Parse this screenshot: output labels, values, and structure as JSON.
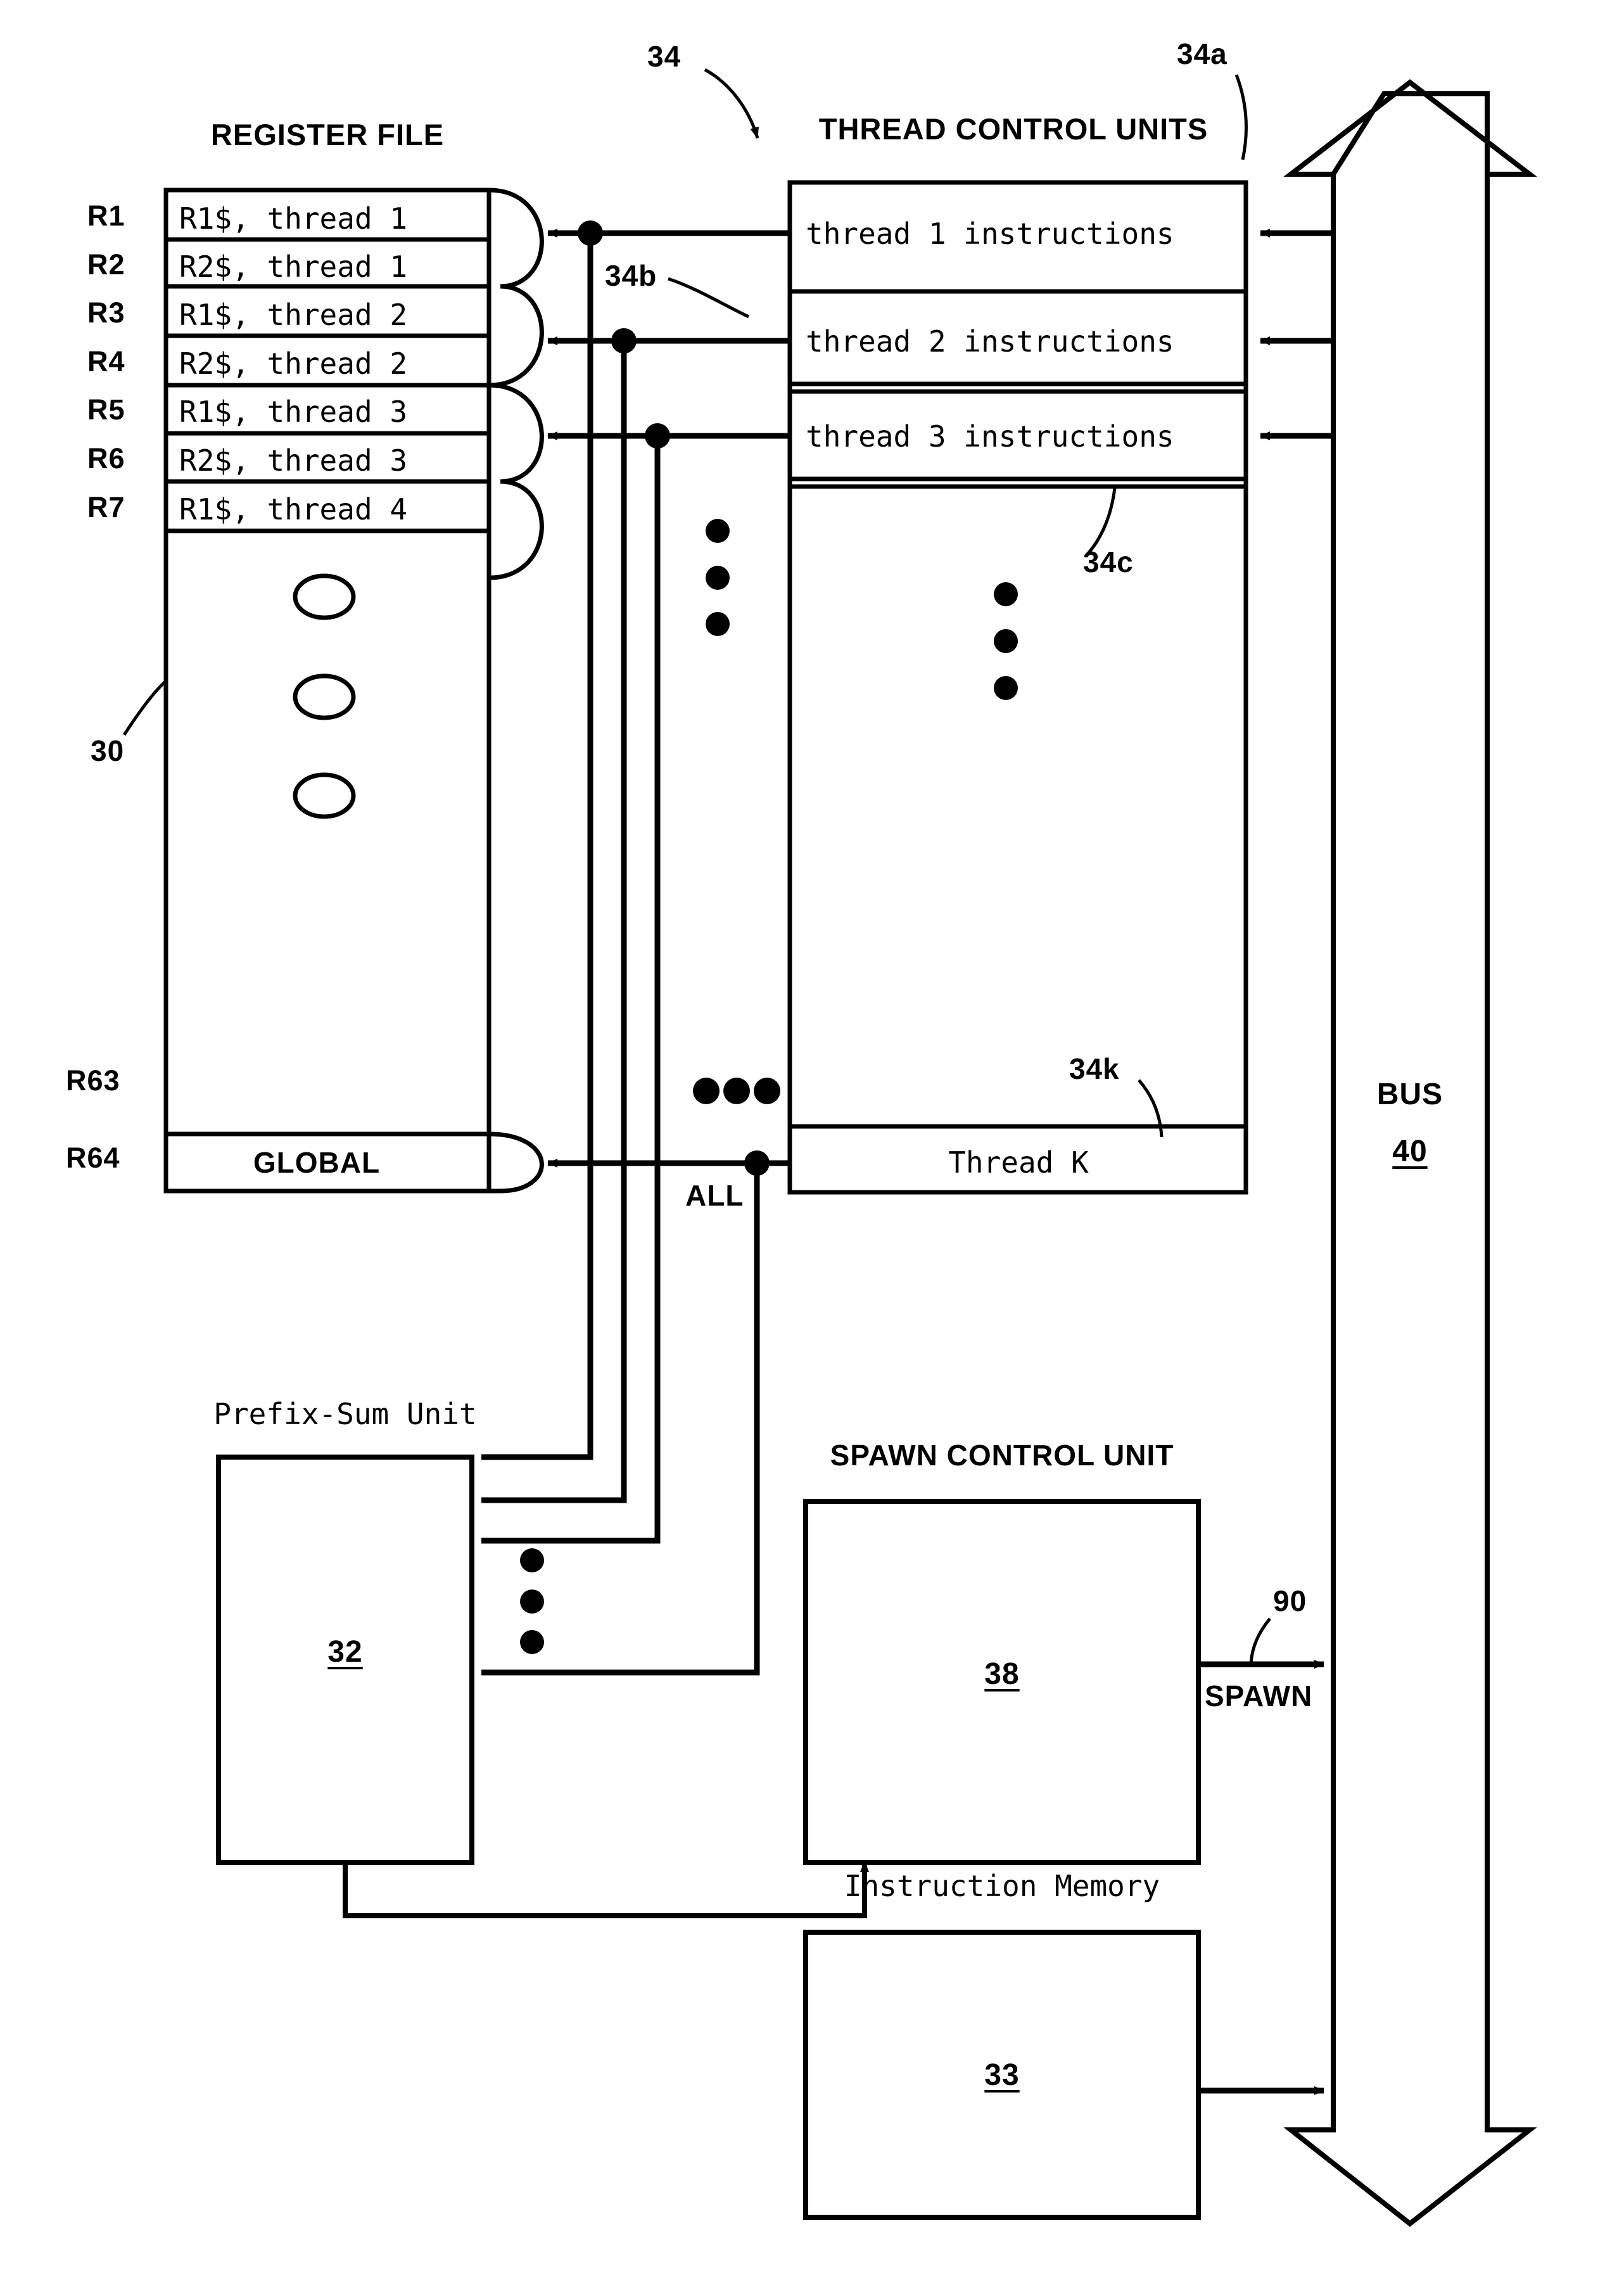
{
  "figure": {
    "title_register_file": "REGISTER FILE",
    "title_thread_control_units": "THREAD CONTROL UNITS",
    "title_prefix_sum_unit": "Prefix-Sum Unit",
    "title_spawn_control_unit": "SPAWN CONTROL UNIT",
    "title_instruction_memory": "Instruction Memory"
  },
  "reference_numerals": {
    "register_file": "30",
    "prefix_sum_unit": "32",
    "instruction_memory": "33",
    "thread_control_units": "34",
    "tcu_a": "34a",
    "tcu_b": "34b",
    "tcu_c": "34c",
    "tcu_k": "34k",
    "spawn_control_unit": "38",
    "bus": "40",
    "spawn_signal": "90"
  },
  "register_file": {
    "rows": [
      {
        "index": "R1",
        "content": "R1$, thread 1"
      },
      {
        "index": "R2",
        "content": "R2$, thread 1"
      },
      {
        "index": "R3",
        "content": "R1$, thread 2"
      },
      {
        "index": "R4",
        "content": "R2$, thread 2"
      },
      {
        "index": "R5",
        "content": "R1$, thread 3"
      },
      {
        "index": "R6",
        "content": "R2$, thread 3"
      },
      {
        "index": "R7",
        "content": "R1$, thread 4"
      }
    ],
    "ellipsis_row_index": "R63",
    "global_row": {
      "index": "R64",
      "content": "GLOBAL"
    }
  },
  "thread_control_units": {
    "rows": [
      {
        "label": "thread 1 instructions"
      },
      {
        "label": "thread 2 instructions"
      },
      {
        "label": "thread 3 instructions"
      }
    ],
    "last_row": {
      "label": "Thread K"
    }
  },
  "signals": {
    "all": "ALL",
    "spawn": "SPAWN",
    "bus": "BUS"
  },
  "colors": {
    "ink": "#000000",
    "paper": "#ffffff"
  }
}
